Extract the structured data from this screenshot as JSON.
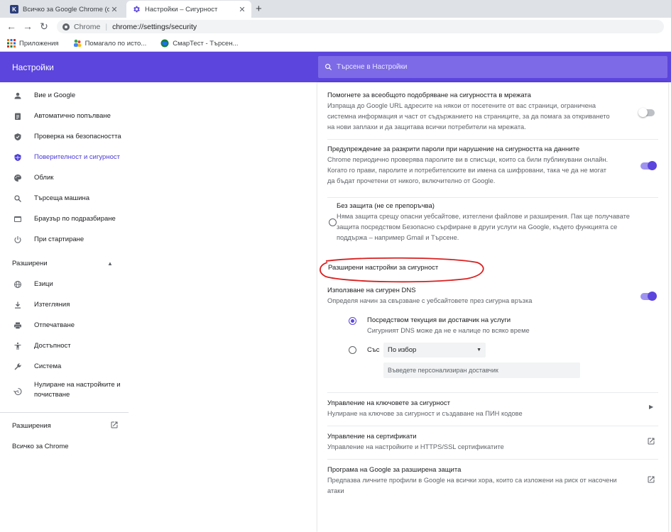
{
  "tabs": [
    {
      "title": "Всичко за Google Chrome (обед",
      "favicon": "K",
      "favicon_color": "#2c3e7a"
    },
    {
      "title": "Настройки – Сигурност",
      "favicon": "gear-icon"
    }
  ],
  "toolbar": {
    "url_site": "Chrome",
    "url_path": "chrome://settings/security"
  },
  "bookmarks": [
    {
      "label": "Приложения",
      "icon": "apps-grid-icon"
    },
    {
      "label": "Помагало по исто...",
      "icon": "people-icon"
    },
    {
      "label": "СмарТест - Търсен...",
      "icon": "globe-icon"
    }
  ],
  "header": {
    "title": "Настройки",
    "search_placeholder": "Търсене в Настройки",
    "color": "#5b45dd"
  },
  "sidebar": {
    "items": [
      {
        "label": "Вие и Google",
        "icon": "person-icon"
      },
      {
        "label": "Автоматично попълване",
        "icon": "clipboard-icon"
      },
      {
        "label": "Проверка на безопасността",
        "icon": "shield-check-icon"
      },
      {
        "label": "Поверителност и сигурност",
        "icon": "shield-lock-icon",
        "active": true
      },
      {
        "label": "Облик",
        "icon": "palette-icon"
      },
      {
        "label": "Търсеща машина",
        "icon": "search-icon"
      },
      {
        "label": "Браузър по подразбиране",
        "icon": "browser-icon"
      },
      {
        "label": "При стартиране",
        "icon": "power-icon"
      }
    ],
    "advanced_label": "Разширени",
    "advanced_items": [
      {
        "label": "Езици",
        "icon": "globe-icon"
      },
      {
        "label": "Изтегляния",
        "icon": "download-icon"
      },
      {
        "label": "Отпечатване",
        "icon": "printer-icon"
      },
      {
        "label": "Достъпност",
        "icon": "accessibility-icon"
      },
      {
        "label": "Система",
        "icon": "wrench-icon"
      },
      {
        "label": "Нулиране на настройките и почистване",
        "icon": "restore-icon"
      }
    ],
    "extensions_label": "Разширения",
    "about_label": "Всичко за Chrome"
  },
  "main": {
    "help_improve": {
      "title": "Помогнете за всеобщото подобряване на сигурността в мрежата",
      "desc": "Изпраща до Google URL адресите на някои от посетените от вас страници, ограничена системна информация и част от съдържанието на страниците, за да помага за откриването на нови заплахи и да защитава всички потребители на мрежата.",
      "enabled": false
    },
    "password_leak": {
      "title": "Предупреждение за разкрити пароли при нарушение на сигурността на данните",
      "desc": "Chrome периодично проверява паролите ви в списъци, които са били публикувани онлайн. Когато го прави, паролите и потребителските ви имена са шифровани, така че да не могат да бъдат прочетени от никого, включително от Google.",
      "enabled": true
    },
    "no_protection": {
      "title": "Без защита (не се препоръчва)",
      "desc": "Няма защита срещу опасни уебсайтове, изтеглени файлове и разширения. Пак ще получавате защита посредством Безопасно сърфиране в други услуги на Google, където функцията се поддържа – например Gmail и Търсене."
    },
    "advanced_heading": "Разширени настройки за сигурност",
    "secure_dns": {
      "title": "Използване на сигурен DNS",
      "desc": "Определя начин за свързване с уебсайтовете през сигурна връзка",
      "enabled": true,
      "option_current_title": "Посредством текущия ви доставчик на услуги",
      "option_current_desc": "Сигурният DNS може да не е налице по всяко време",
      "option_with_label": "Със",
      "dropdown_value": "По избор",
      "custom_placeholder": "Въведете персонализиран доставчик"
    },
    "security_keys": {
      "title": "Управление на ключовете за сигурност",
      "desc": "Нулиране на ключове за сигурност и създаване на ПИН кодове"
    },
    "certificates": {
      "title": "Управление на сертификати",
      "desc": "Управление на настройките и HTTPS/SSL сертификатите"
    },
    "advanced_protection": {
      "title": "Програма на Google за разширена защита",
      "desc": "Предпазва личните профили в Google на всички хора, които са изложени на риск от насочени атаки"
    }
  }
}
